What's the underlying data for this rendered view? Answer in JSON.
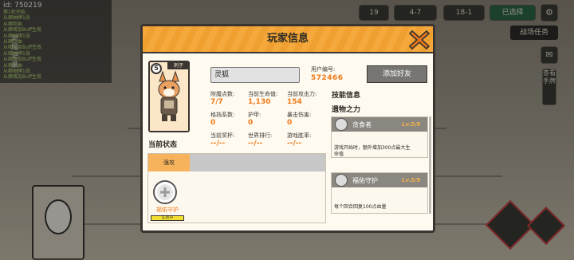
{
  "hud": {
    "log_id": "id: 750219",
    "log_lines": [
      "第1轮开始",
      "从卿抽牌1张",
      "从卿回血",
      "从卿增加Buff生效",
      "从卿抽牌1张",
      "从卿回血",
      "从卿增加Buff生效",
      "从卿抽牌1张",
      "从卿增加Buff生效",
      "从卿回血",
      "从卿抽牌1张",
      "从卿增加Buff生效"
    ],
    "side_label": "对局记录",
    "chip_1": "19",
    "chip_2": "4-7",
    "chip_3": "18-1",
    "chip_4": "已选择",
    "battle_task": "战场任务",
    "right_tab": "查看手牌"
  },
  "dialog": {
    "title": "玩家信息",
    "card": {
      "cost": "5",
      "tag": "刺子"
    },
    "name": "灵狐",
    "uid_label": "用户编号:",
    "uid": "572466",
    "add_friend": "添加好友",
    "stats": [
      {
        "label": "附魔点数:",
        "value": "7/7"
      },
      {
        "label": "当前生命值:",
        "value": "1,130"
      },
      {
        "label": "当前攻击力:",
        "value": "154"
      },
      {
        "label": "格挡系数:",
        "value": "0"
      },
      {
        "label": "护甲:",
        "value": "0"
      },
      {
        "label": "暴击伤害:",
        "value": "0"
      },
      {
        "label": "当前奖杯:",
        "value": "--/--"
      },
      {
        "label": "世界排行:",
        "value": "--/--"
      },
      {
        "label": "游戏胜率:",
        "value": "--/--"
      }
    ],
    "status_title": "当前状态",
    "status_tab": "强攻",
    "buff": {
      "name": "福佑守护",
      "bar": "生效中"
    },
    "skill_title": "技能信息",
    "skill_subtitle": "遗物之力",
    "skills": [
      {
        "name": "贪食者",
        "level": "Lv.5/9",
        "desc": "游戏开始时，额外增加300点最大生命值",
        "accent": "#f07a18"
      },
      {
        "name": "福佑守护",
        "level": "Lv.5/9",
        "desc": "每个回合回复100点血量",
        "accent": "#f07a18"
      }
    ]
  },
  "colors": {
    "header": "#f5a83c",
    "accent": "#f07a18",
    "frame": "#3a3530"
  }
}
